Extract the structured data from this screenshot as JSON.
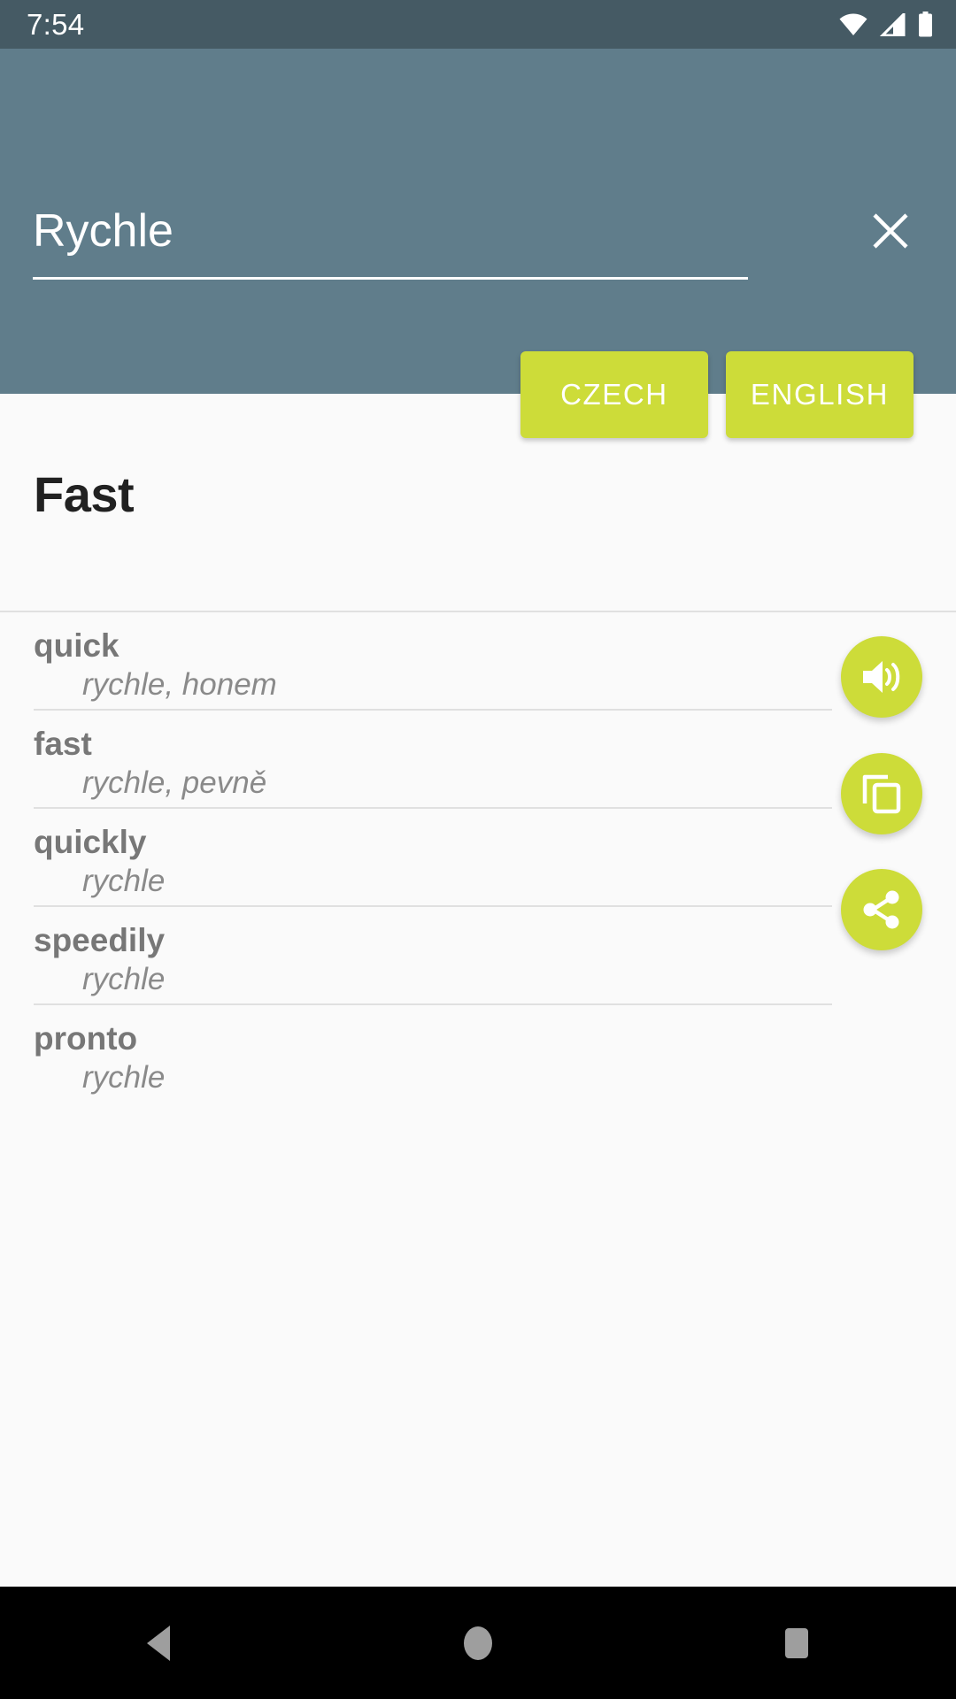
{
  "status_bar": {
    "time": "7:54",
    "icons": [
      "wifi-icon",
      "cell-signal-icon",
      "battery-icon"
    ]
  },
  "header": {
    "background_color": "#607d8b",
    "search": {
      "value": "Rychle",
      "placeholder": "Search",
      "clear_icon": "close-icon"
    },
    "language_buttons": [
      {
        "label": "CZECH",
        "name": "czech-button"
      },
      {
        "label": "ENGLISH",
        "name": "english-button"
      }
    ],
    "accent_color": "#cddc39"
  },
  "content": {
    "result_title": "Fast",
    "entries": [
      {
        "term": "quick",
        "definition": "rychle, honem"
      },
      {
        "term": "fast",
        "definition": "rychle, pevně"
      },
      {
        "term": "quickly",
        "definition": "rychle"
      },
      {
        "term": "speedily",
        "definition": "rychle"
      },
      {
        "term": "pronto",
        "definition": "rychle"
      }
    ]
  },
  "actions": [
    {
      "name": "speak-button",
      "icon": "volume-up-icon"
    },
    {
      "name": "copy-button",
      "icon": "copy-icon"
    },
    {
      "name": "share-button",
      "icon": "share-icon"
    }
  ],
  "nav_bar": {
    "buttons": [
      {
        "name": "nav-back-button",
        "icon": "back-triangle-icon"
      },
      {
        "name": "nav-home-button",
        "icon": "home-circle-icon"
      },
      {
        "name": "nav-recents-button",
        "icon": "recents-square-icon"
      }
    ]
  }
}
